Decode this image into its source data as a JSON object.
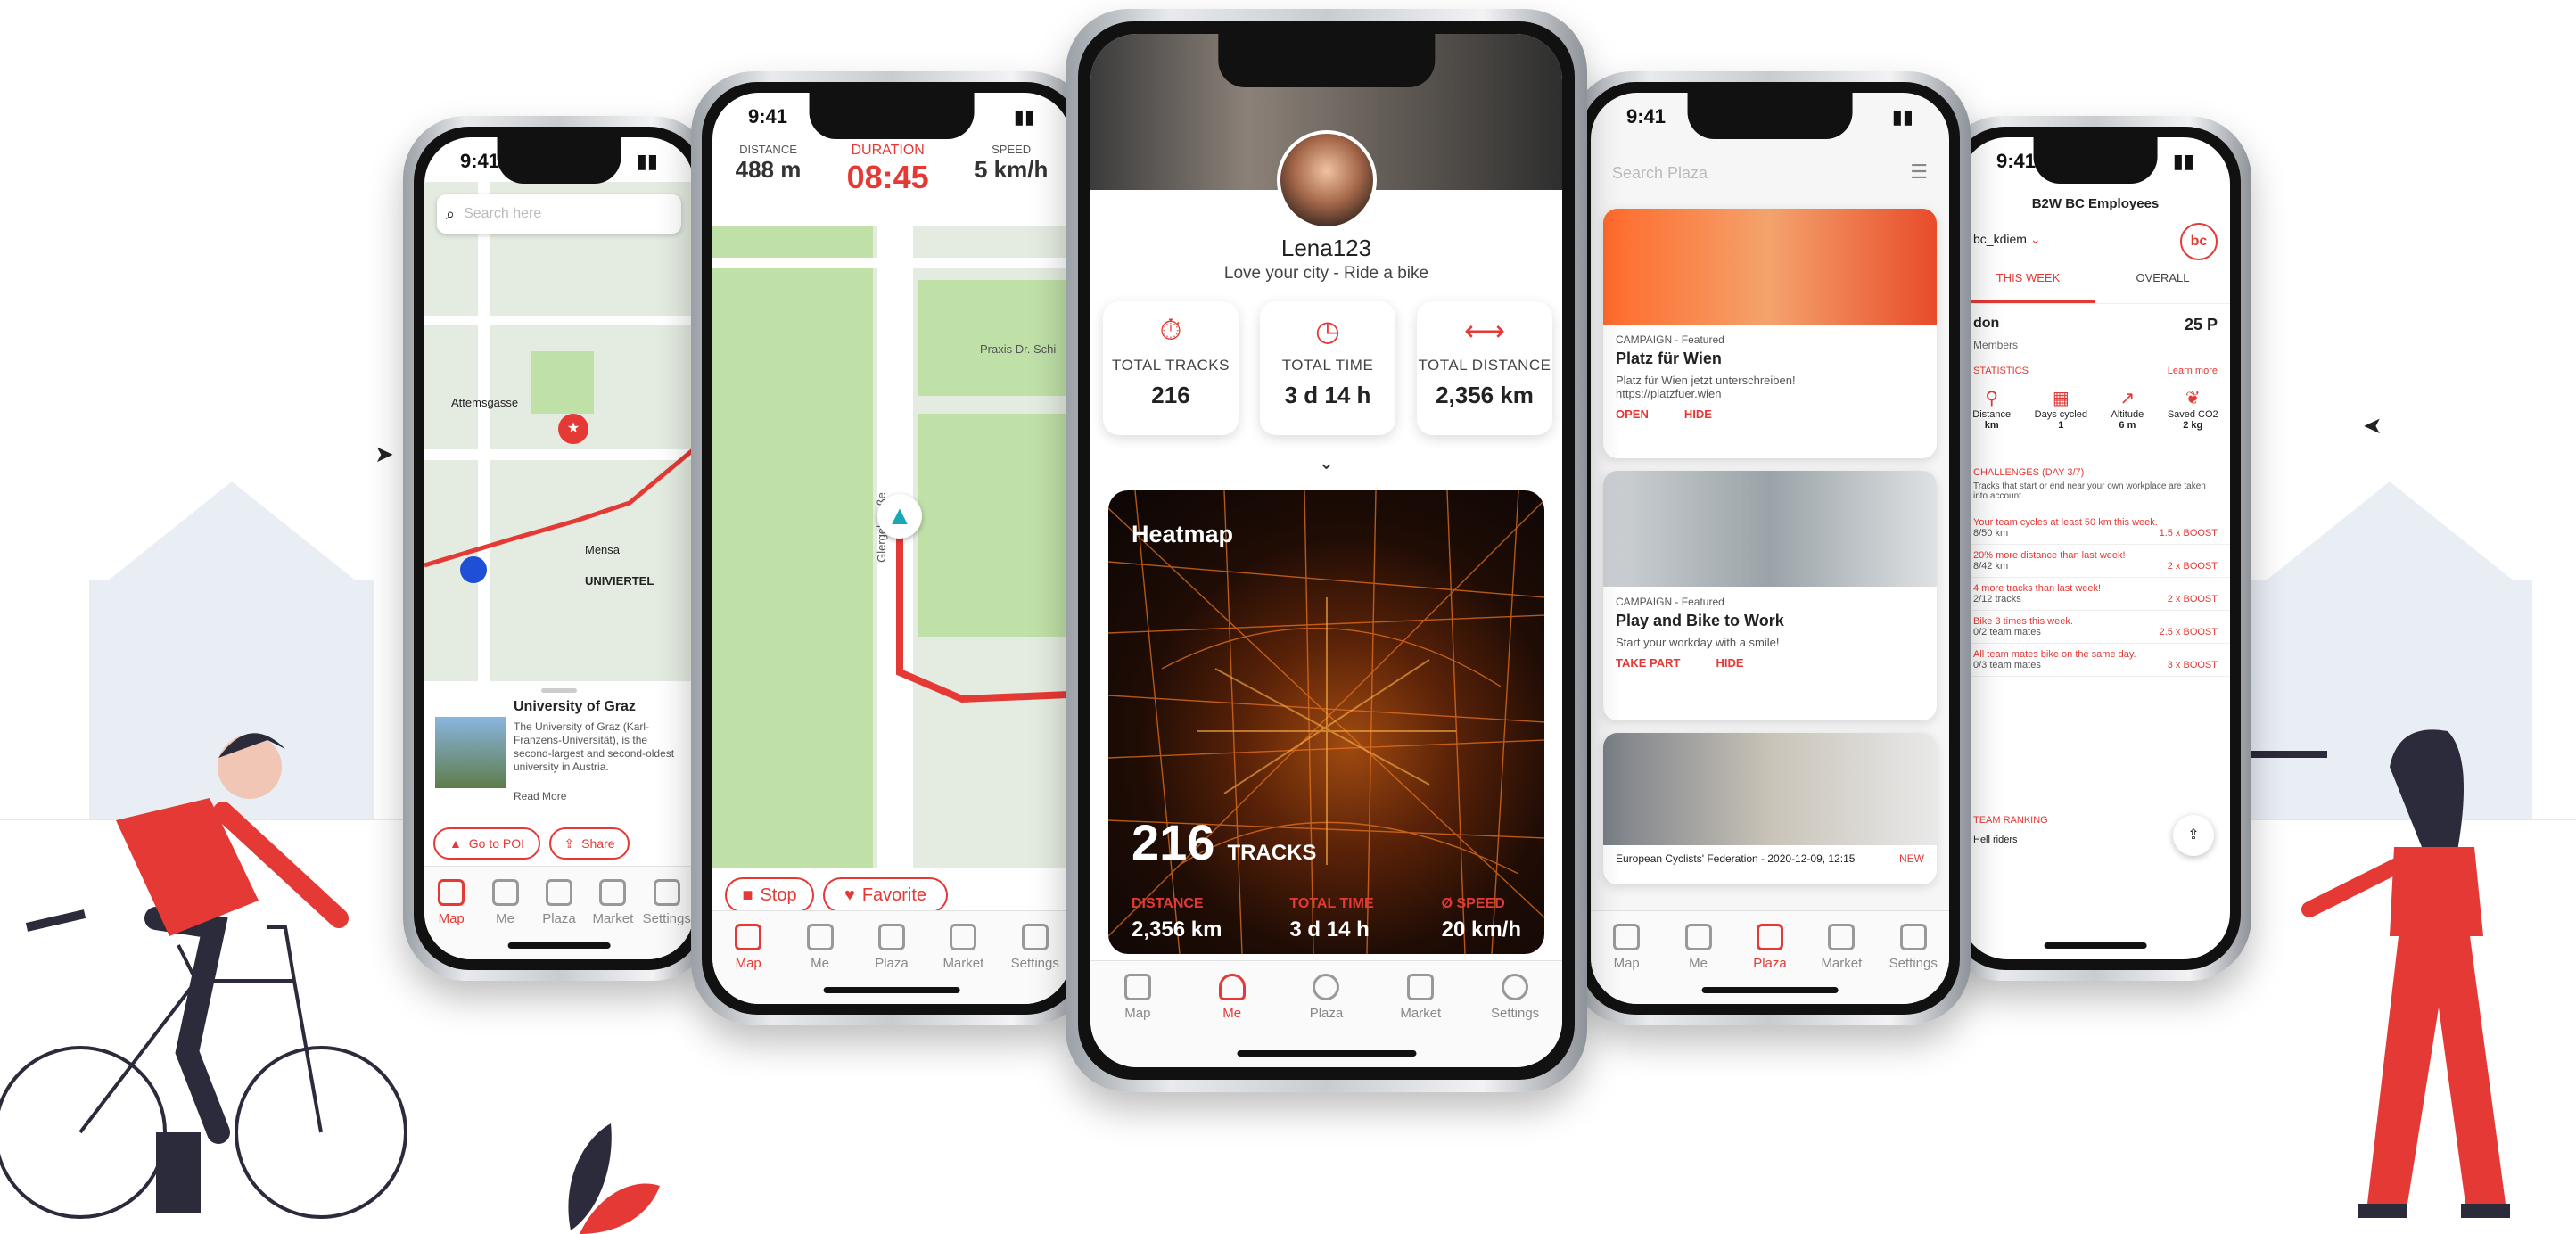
{
  "colors": {
    "accent": "#e53935",
    "dark": "#111111",
    "map_green": "#bfe0a7"
  },
  "phone1": {
    "time": "9:41",
    "search_placeholder": "Search here",
    "map_labels": [
      "Mensa",
      "UNIVIERTEL",
      "Attemsgasse"
    ],
    "poi": {
      "title": "University of Graz",
      "desc": "The University of Graz (Karl-Franzens-Universität), is the second-largest and second-oldest university in Austria.",
      "read_more": "Read More"
    },
    "go_to_poi": "Go to POI",
    "share": "Share",
    "tabs": [
      "Map",
      "Me",
      "Plaza",
      "Market",
      "Settings"
    ]
  },
  "phone2": {
    "time": "9:41",
    "distance_label": "DISTANCE",
    "distance_value": "488 m",
    "duration_label": "DURATION",
    "duration_value": "08:45",
    "speed_label": "SPEED",
    "speed_value": "5 km/h",
    "map_labels": [
      "Praxis Dr. Schi",
      "Glergelstraße"
    ],
    "stop": "Stop",
    "favorite": "Favorite",
    "tabs": [
      "Map",
      "Me",
      "Plaza",
      "Market",
      "Settings"
    ]
  },
  "phone3": {
    "username": "Lena123",
    "tagline": "Love your city - Ride a bike",
    "stats": [
      {
        "label": "TOTAL TRACKS",
        "value": "216",
        "icon": "stopwatch-icon"
      },
      {
        "label": "TOTAL TIME",
        "value": "3 d 14 h",
        "icon": "clock-icon"
      },
      {
        "label": "TOTAL DISTANCE",
        "value": "2,356 km",
        "icon": "distance-arrows-icon"
      }
    ],
    "heatmap_title": "Heatmap",
    "tracks_number": "216",
    "tracks_label": "TRACKS",
    "heat_stats": [
      {
        "label": "DISTANCE",
        "value": "2,356 km"
      },
      {
        "label": "TOTAL TIME",
        "value": "3 d 14 h"
      },
      {
        "label": "Ø SPEED",
        "value": "20 km/h"
      }
    ],
    "tabs": [
      "Map",
      "Me",
      "Plaza",
      "Market",
      "Settings"
    ]
  },
  "phone4": {
    "time": "9:41",
    "search_placeholder": "Search Plaza",
    "cards": [
      {
        "tag": "CAMPAIGN - Featured",
        "title": "Platz für Wien",
        "text": "Platz für Wien jetzt unterschreiben!",
        "link": "https://platzfuer.wien",
        "primary": "OPEN",
        "secondary": "HIDE"
      },
      {
        "tag": "CAMPAIGN - Featured",
        "title": "Play and Bike to Work",
        "text": "Start your workday with a smile!",
        "primary": "TAKE PART",
        "secondary": "HIDE"
      },
      {
        "footer": "European Cyclists' Federation - 2020-12-09, 12:15",
        "badge": "NEW"
      }
    ],
    "tabs": [
      "Map",
      "Me",
      "Plaza",
      "Market",
      "Settings"
    ]
  },
  "phone5": {
    "time": "9:41",
    "title": "B2W BC Employees",
    "user": "bc_kdiem",
    "logo_text": "bc",
    "tabs_top": [
      "THIS WEEK",
      "OVERALL"
    ],
    "team": "don",
    "points": "25 P",
    "members": "Members",
    "stats_header": "STATISTICS",
    "learn_more": "Learn more",
    "stat_items": [
      {
        "label": "Distance",
        "value": "km"
      },
      {
        "label": "Days cycled",
        "value": "1"
      },
      {
        "label": "Altitude",
        "value": "6 m"
      },
      {
        "label": "Saved CO2",
        "value": "2 kg"
      }
    ],
    "challenges_header": "CHALLENGES (DAY 3/7)",
    "challenges_desc": "Tracks that start or end near your own workplace are taken into account.",
    "challenges": [
      {
        "title": "Your team cycles at least 50 km this week.",
        "progress": "8/50 km",
        "boost": "1.5 x BOOST"
      },
      {
        "title": "20% more distance than last week!",
        "progress": "8/42 km",
        "boost": "2 x BOOST"
      },
      {
        "title": "4 more tracks than last week!",
        "progress": "2/12 tracks",
        "boost": "2 x BOOST"
      },
      {
        "title": "Bike 3 times this week.",
        "progress": "0/2 team mates",
        "boost": "2.5 x BOOST"
      },
      {
        "title": "All team mates bike on the same day.",
        "progress": "0/3 team mates",
        "boost": "3 x BOOST"
      }
    ],
    "ranking_header": "TEAM RANKING",
    "ranking_item": "Hell riders"
  }
}
